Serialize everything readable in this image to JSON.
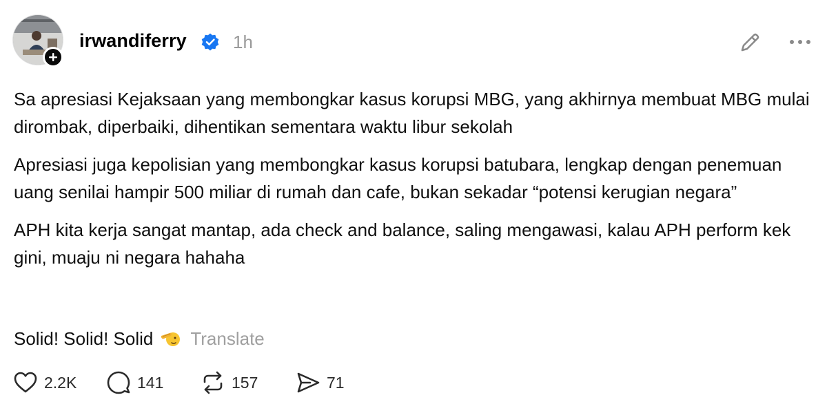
{
  "post": {
    "username": "irwandiferry",
    "timestamp": "1h",
    "paragraphs": [
      "Sa apresiasi Kejaksaan yang membongkar kasus korupsi MBG, yang akhirnya membuat MBG mulai dirombak, diperbaiki, dihentikan sementara waktu libur sekolah",
      "Apresiasi juga kepolisian yang membongkar kasus korupsi batubara, lengkap dengan penemuan uang senilai hampir 500 miliar di rumah dan cafe, bukan sekadar “potensi kerugian negara”",
      "APH kita kerja sangat mantap, ada check and balance, saling mengawasi, kalau APH perform kek gini, muaju ni negara hahaha"
    ],
    "last_line": "Solid! Solid! Solid",
    "translate_label": "Translate"
  },
  "actions": {
    "likes": "2.2K",
    "replies": "141",
    "reposts": "157",
    "shares": "71"
  },
  "icons": {
    "verified": "verified-badge-icon",
    "follow": "plus-icon",
    "edit": "pencil-icon",
    "more": "more-dots-icon",
    "like": "heart-icon",
    "reply": "comment-bubble-icon",
    "repost": "repost-icon",
    "share": "send-icon",
    "emoji": "saluting-face-emoji"
  },
  "colors": {
    "verified": "#1877f2",
    "muted": "#9a9a9a",
    "text": "#101010"
  }
}
